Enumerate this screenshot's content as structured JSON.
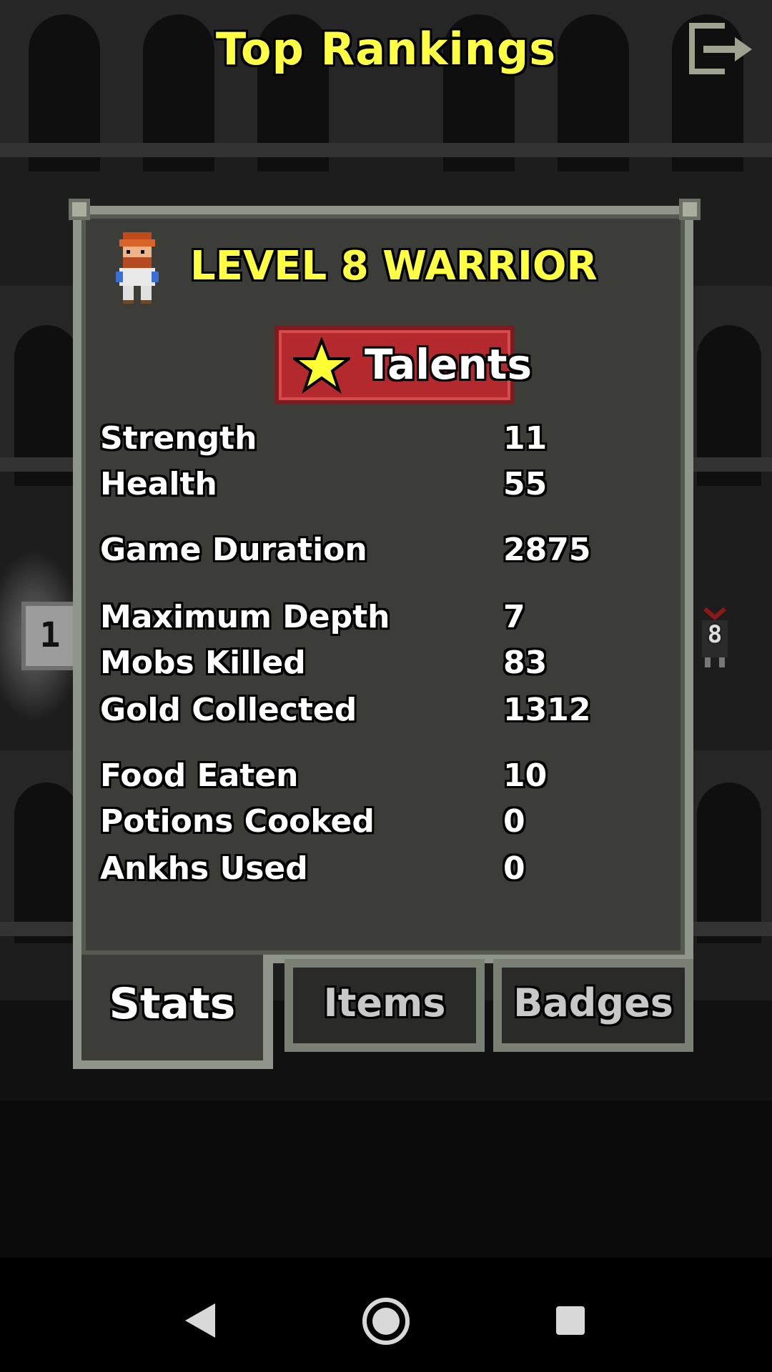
{
  "header": {
    "title": "Top Rankings",
    "exit_icon": "exit-icon"
  },
  "rank_markers": {
    "left": "1",
    "right": "8"
  },
  "record": {
    "title": "LEVEL 8 WARRIOR",
    "portrait_icon": "warrior-portrait-icon",
    "talents_button": {
      "label": "Talents",
      "icon": "star-icon"
    },
    "stats": [
      {
        "label": "Strength",
        "value": "11"
      },
      {
        "label": "Health",
        "value": "55"
      },
      {
        "label": "Game Duration",
        "value": "2875"
      },
      {
        "label": "Maximum Depth",
        "value": "7"
      },
      {
        "label": "Mobs Killed",
        "value": "83"
      },
      {
        "label": "Gold Collected",
        "value": "1312"
      },
      {
        "label": "Food Eaten",
        "value": "10"
      },
      {
        "label": "Potions Cooked",
        "value": "0"
      },
      {
        "label": "Ankhs Used",
        "value": "0"
      }
    ]
  },
  "tabs": [
    {
      "label": "Stats",
      "active": true
    },
    {
      "label": "Items",
      "active": false
    },
    {
      "label": "Badges",
      "active": false
    }
  ],
  "navbar": {
    "back_icon": "back-triangle-icon",
    "home_icon": "home-circle-icon",
    "recent_icon": "recent-apps-square-icon"
  },
  "colors": {
    "title_yellow": "#ffff44",
    "panel_bg": "#3c3d39",
    "panel_border": "#8f958a",
    "talents_red": "#b3292e"
  }
}
